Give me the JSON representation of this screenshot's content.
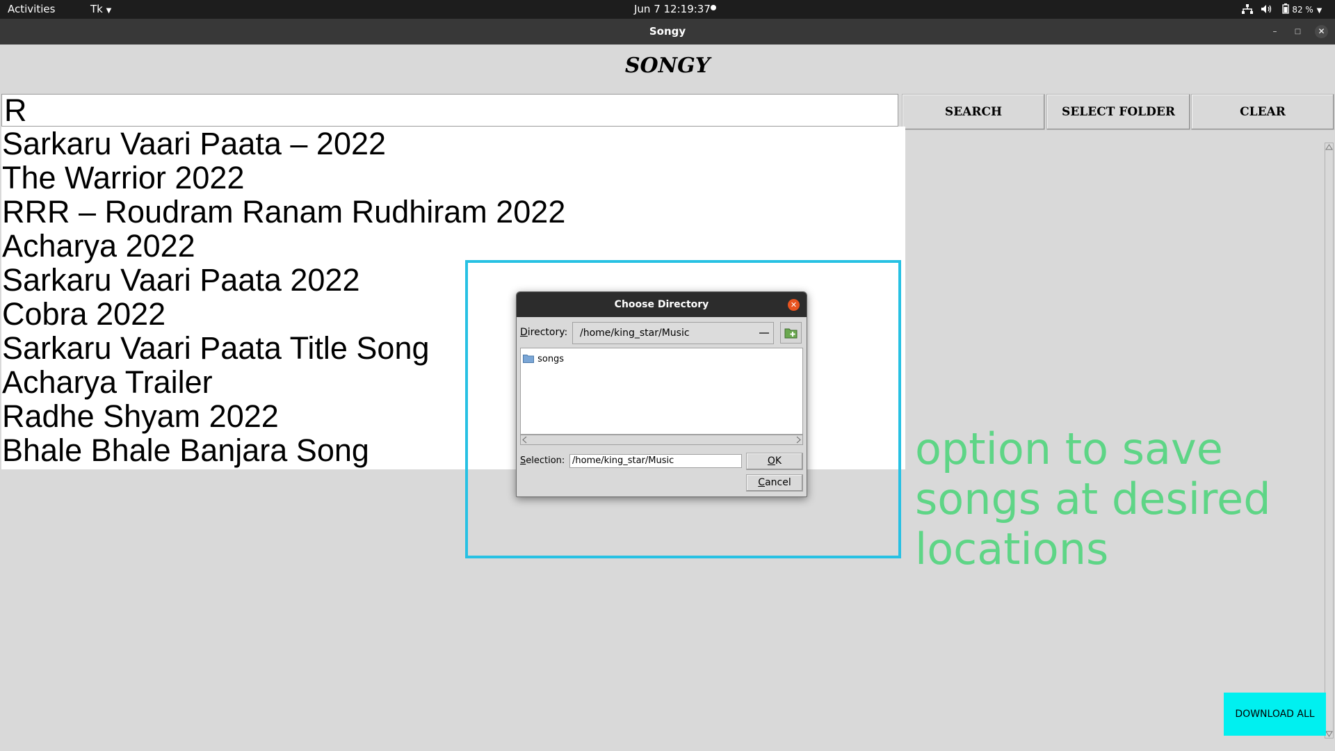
{
  "topbar": {
    "activities": "Activities",
    "app_menu": "Tk",
    "datetime": "Jun 7  12:19:37",
    "battery": "82 %"
  },
  "window": {
    "title": "Songy"
  },
  "app": {
    "heading": "SONGY",
    "search_value": "R",
    "buttons": {
      "search": "SEARCH",
      "select_folder": "SELECT FOLDER",
      "clear": "CLEAR",
      "download_all": "DOWNLOAD ALL"
    },
    "results": [
      "Sarkaru Vaari Paata – 2022",
      "The Warrior 2022",
      "RRR – Roudram Ranam Rudhiram 2022",
      "Acharya 2022",
      "Sarkaru Vaari Paata 2022",
      "Cobra 2022",
      "Sarkaru Vaari Paata Title Song",
      "Acharya Trailer",
      "Radhe Shyam 2022",
      "Bhale Bhale Banjara Song"
    ]
  },
  "dialog": {
    "title": "Choose Directory",
    "directory_label_prefix": "D",
    "directory_label_rest": "irectory:",
    "directory_value": "/home/king_star/Music",
    "folders": [
      "songs"
    ],
    "selection_label_prefix": "S",
    "selection_label_rest": "election:",
    "selection_value": "/home/king_star/Music",
    "ok_prefix": "O",
    "ok_rest": "K",
    "cancel_prefix": "C",
    "cancel_rest": "ancel"
  },
  "annotation": {
    "text": "option to save songs at desired locations",
    "color": "#5ed586",
    "highlight_color": "#27c1e3"
  },
  "colors": {
    "download_button": "#00f0f0",
    "dialog_close": "#e95420"
  },
  "icons": [
    "caret-down-icon",
    "network-icon",
    "volume-icon",
    "battery-icon",
    "minimize-icon",
    "maximize-icon",
    "close-icon",
    "folder-icon",
    "new-folder-icon",
    "scroll-left-icon",
    "scroll-right-icon",
    "scroll-up-icon",
    "scroll-down-icon"
  ]
}
